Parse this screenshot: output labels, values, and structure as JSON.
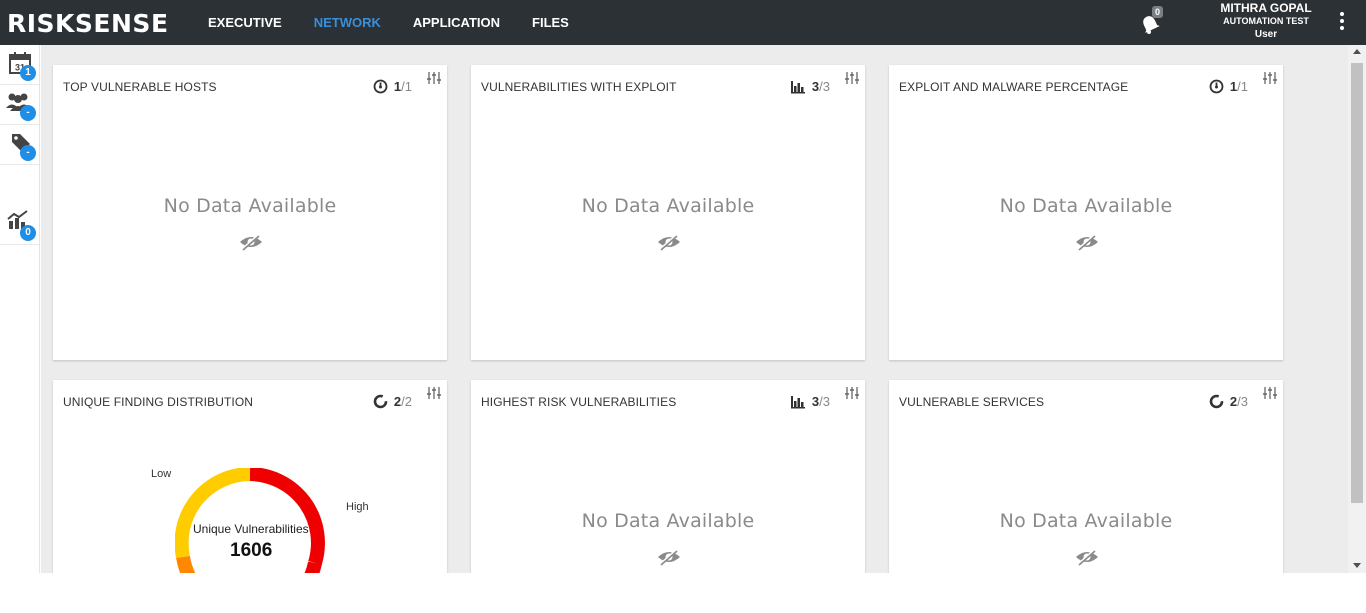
{
  "brand": {
    "logo_text": "RISKSENSE"
  },
  "nav": {
    "items": [
      {
        "label": "EXECUTIVE",
        "active": false
      },
      {
        "label": "NETWORK",
        "active": true
      },
      {
        "label": "APPLICATION",
        "active": false
      },
      {
        "label": "FILES",
        "active": false
      }
    ]
  },
  "notifications": {
    "count": "0"
  },
  "user": {
    "name": "MITHRA GOPAL",
    "org": "AUTOMATION TEST",
    "role": "User"
  },
  "sidebar": {
    "items": [
      {
        "icon": "calendar-icon",
        "badge": "1",
        "calendar_day": "31"
      },
      {
        "icon": "users-icon",
        "badge": "-"
      },
      {
        "icon": "tag-icon",
        "badge": "-"
      },
      {
        "icon": "trend-chart-icon",
        "badge": "0"
      }
    ]
  },
  "cards": [
    {
      "title": "TOP VULNERABLE HOSTS",
      "count_icon": "gauge-icon",
      "count": "1",
      "total": "/1",
      "message": "No Data Available"
    },
    {
      "title": "VULNERABILITIES WITH EXPLOIT",
      "count_icon": "bar-chart-icon",
      "count": "3",
      "total": "/3",
      "message": "No Data Available"
    },
    {
      "title": "EXPLOIT AND MALWARE PERCENTAGE",
      "count_icon": "gauge-icon",
      "count": "1",
      "total": "/1",
      "message": "No Data Available"
    },
    {
      "title": "UNIQUE FINDING DISTRIBUTION",
      "count_icon": "donut-icon",
      "count": "2",
      "total": "/2",
      "message": ""
    },
    {
      "title": "HIGHEST RISK VULNERABILITIES",
      "count_icon": "bar-chart-icon",
      "count": "3",
      "total": "/3",
      "message": "No Data Available"
    },
    {
      "title": "VULNERABLE SERVICES",
      "count_icon": "donut-icon",
      "count": "2",
      "total": "/3",
      "message": "No Data Available"
    }
  ],
  "chart_data": {
    "type": "pie",
    "center_label": "Unique Vulnerabilities",
    "center_value": "1606",
    "labels": [
      "Low",
      "High"
    ],
    "colors": {
      "high": "#ee0000",
      "medium": "#ffcc00",
      "low": "#ff8800"
    }
  }
}
